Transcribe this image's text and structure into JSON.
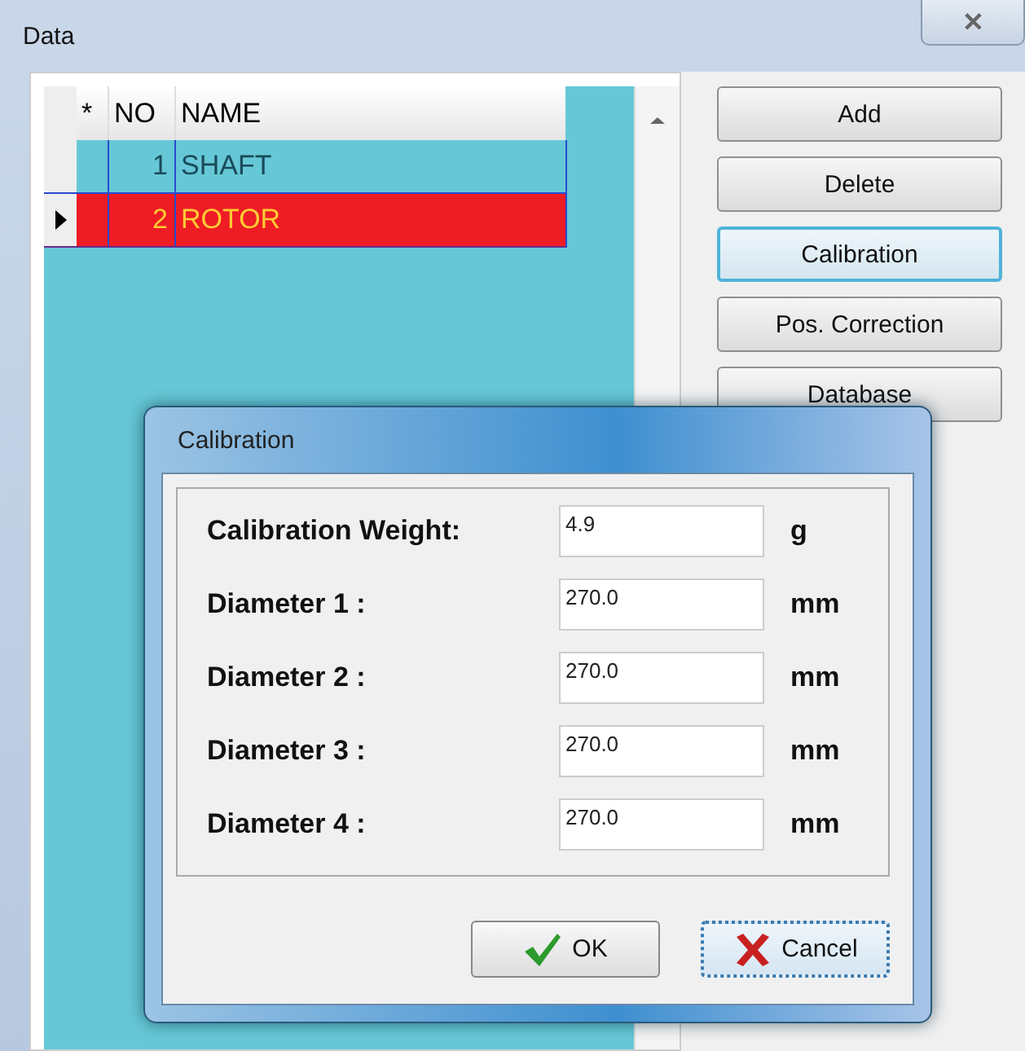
{
  "window": {
    "title": "Data",
    "close": "✕"
  },
  "table": {
    "columns": [
      "*",
      "NO",
      "NAME"
    ],
    "rows": [
      {
        "no": "1",
        "name": "SHAFT",
        "selected": false
      },
      {
        "no": "2",
        "name": "ROTOR",
        "selected": true
      }
    ]
  },
  "buttons": [
    {
      "label": "Add",
      "focused": false
    },
    {
      "label": "Delete",
      "focused": false
    },
    {
      "label": "Calibration",
      "focused": true
    },
    {
      "label": "Pos. Correction",
      "focused": false
    },
    {
      "label": "Database",
      "focused": false
    }
  ],
  "dialog": {
    "title": "Calibration",
    "fields": [
      {
        "label": "Calibration Weight:",
        "value": "4.9",
        "unit": "g"
      },
      {
        "label": "Diameter 1 :",
        "value": "270.0",
        "unit": "mm"
      },
      {
        "label": "Diameter 2 :",
        "value": "270.0",
        "unit": "mm"
      },
      {
        "label": "Diameter 3 :",
        "value": "270.0",
        "unit": "mm"
      },
      {
        "label": "Diameter 4 :",
        "value": "270.0",
        "unit": "mm"
      }
    ],
    "buttons": [
      {
        "kind": "ok",
        "label": "OK",
        "focused": false
      },
      {
        "kind": "cancel",
        "label": "Cancel",
        "focused": true
      }
    ]
  }
}
